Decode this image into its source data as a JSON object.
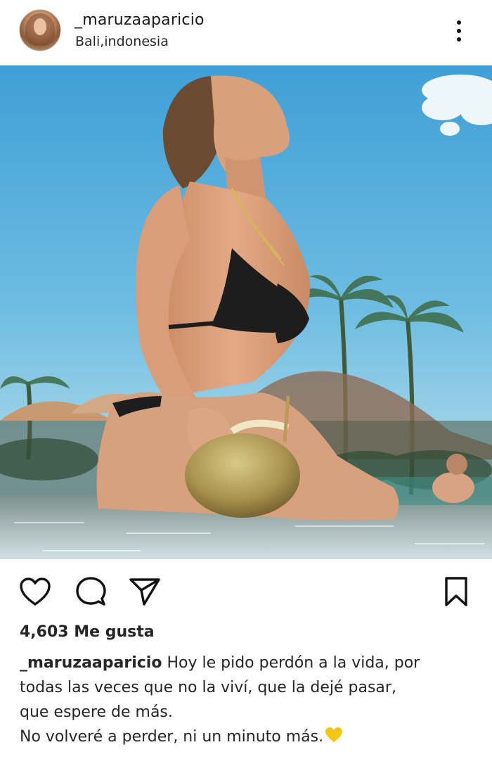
{
  "post": {
    "username": "_maruzaaparicio",
    "location": "Bali,indonesia",
    "likes_text": "4,603 Me gusta",
    "caption": {
      "username": "_maruzaaparicio",
      "line1_text": " Hoy le pido perdón a la vida, por",
      "line2": "todas las veces que no la viví, que la dejé pasar,",
      "line3": "que espere de más.",
      "line4": "No volveré a perder, ni un minuto más."
    }
  },
  "icons": {
    "more": "more-vertical-icon",
    "like": "heart-outline-icon",
    "comment": "comment-bubble-icon",
    "share": "paper-plane-icon",
    "save": "bookmark-icon",
    "caption_emoji": "yellow-heart-emoji"
  },
  "colors": {
    "text": "#262626",
    "emoji_heart": "#f5c518"
  }
}
